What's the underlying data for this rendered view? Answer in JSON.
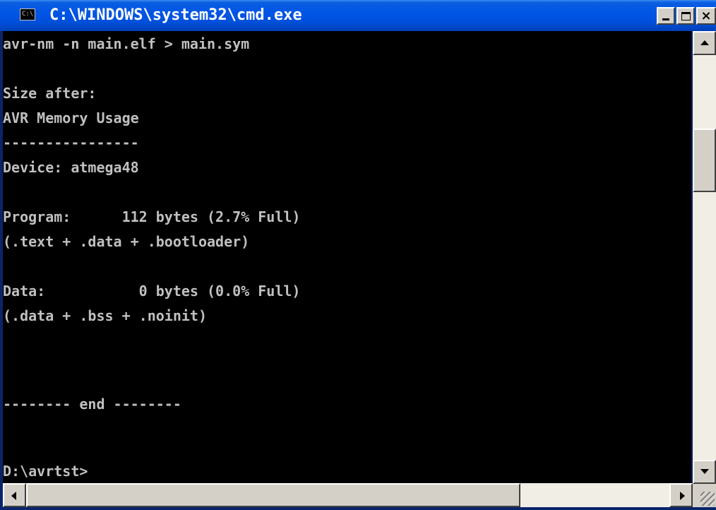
{
  "window": {
    "title": "C:\\WINDOWS\\system32\\cmd.exe",
    "icon_text": "C:\\"
  },
  "console": {
    "lines": [
      "avr-nm -n main.elf > main.sym",
      "",
      "Size after:",
      "AVR Memory Usage",
      "----------------",
      "Device: atmega48",
      "",
      "Program:      112 bytes (2.7% Full)",
      "(.text + .data + .bootloader)",
      "",
      "Data:           0 bytes (0.0% Full)",
      "(.data + .bss + .noinit)",
      "",
      "",
      "",
      "-------- end --------",
      "",
      "",
      "D:\\avrtst>"
    ]
  },
  "scrollbars": {
    "vertical_position_fraction": 0.15,
    "horizontal_position_fraction": 0.0
  },
  "icons": {
    "app": "cmd-icon",
    "minimize": "minimize-icon",
    "maximize": "maximize-icon",
    "close": "close-icon"
  },
  "colors": {
    "titlebar": "#0055e5",
    "console_bg": "#000000",
    "console_text": "#c0c0c0"
  }
}
